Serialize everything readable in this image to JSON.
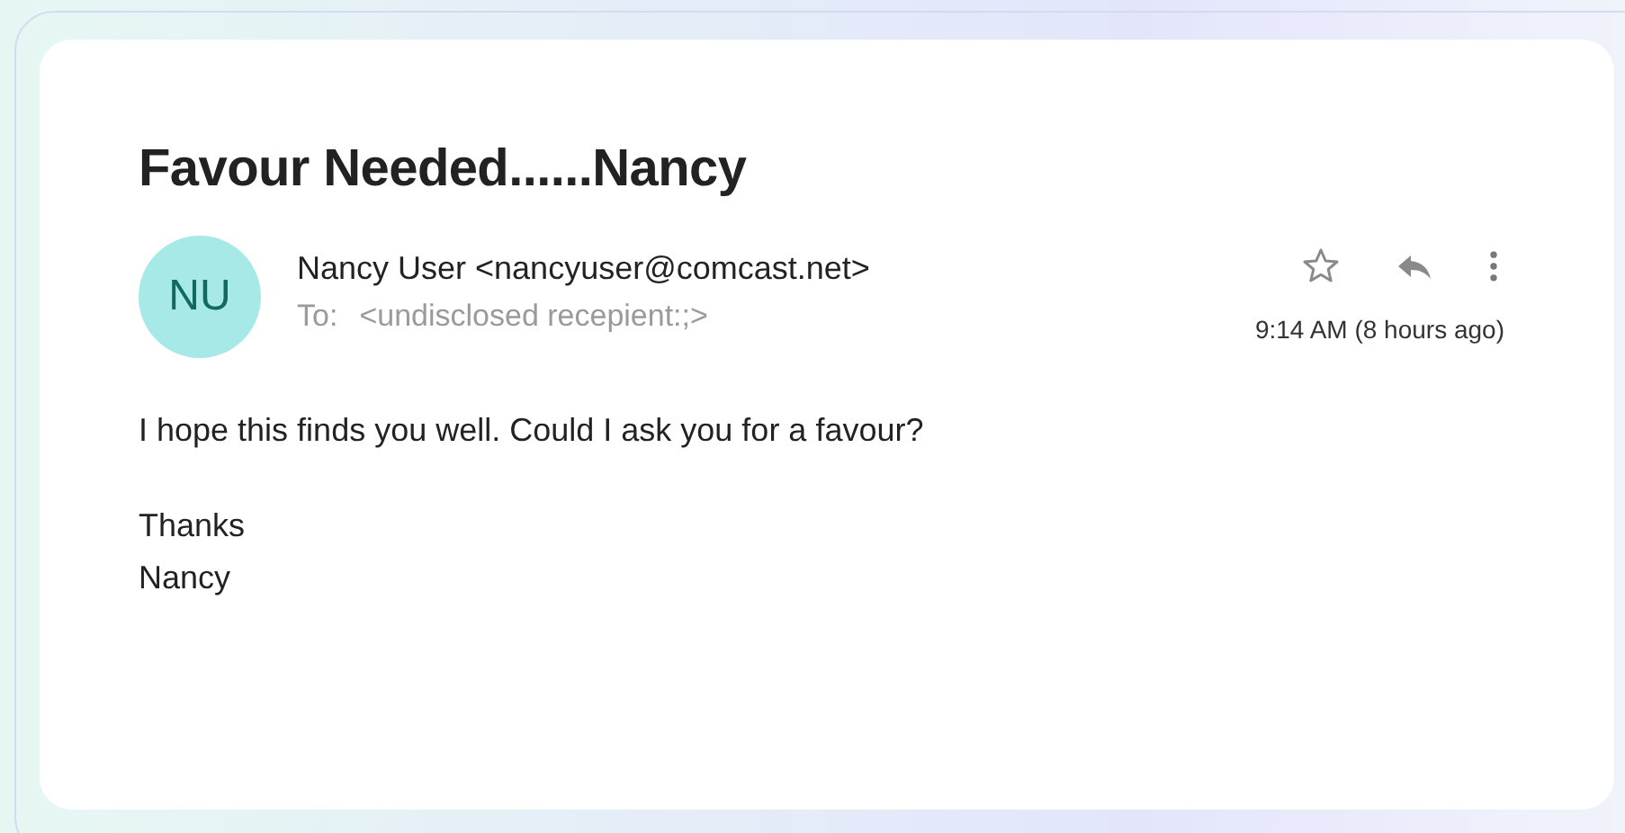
{
  "message": {
    "subject": "Favour Needed......Nancy",
    "sender": {
      "initials": "NU",
      "from": "Nancy User <nancyuser@comcast.net>",
      "to_label": "To:",
      "to": "<undisclosed recepient:;>"
    },
    "starred": false,
    "time": "9:14 AM (8 hours ago)",
    "body": [
      "I hope this finds you well. Could I ask you for a favour?",
      "Thanks\nNancy"
    ]
  }
}
